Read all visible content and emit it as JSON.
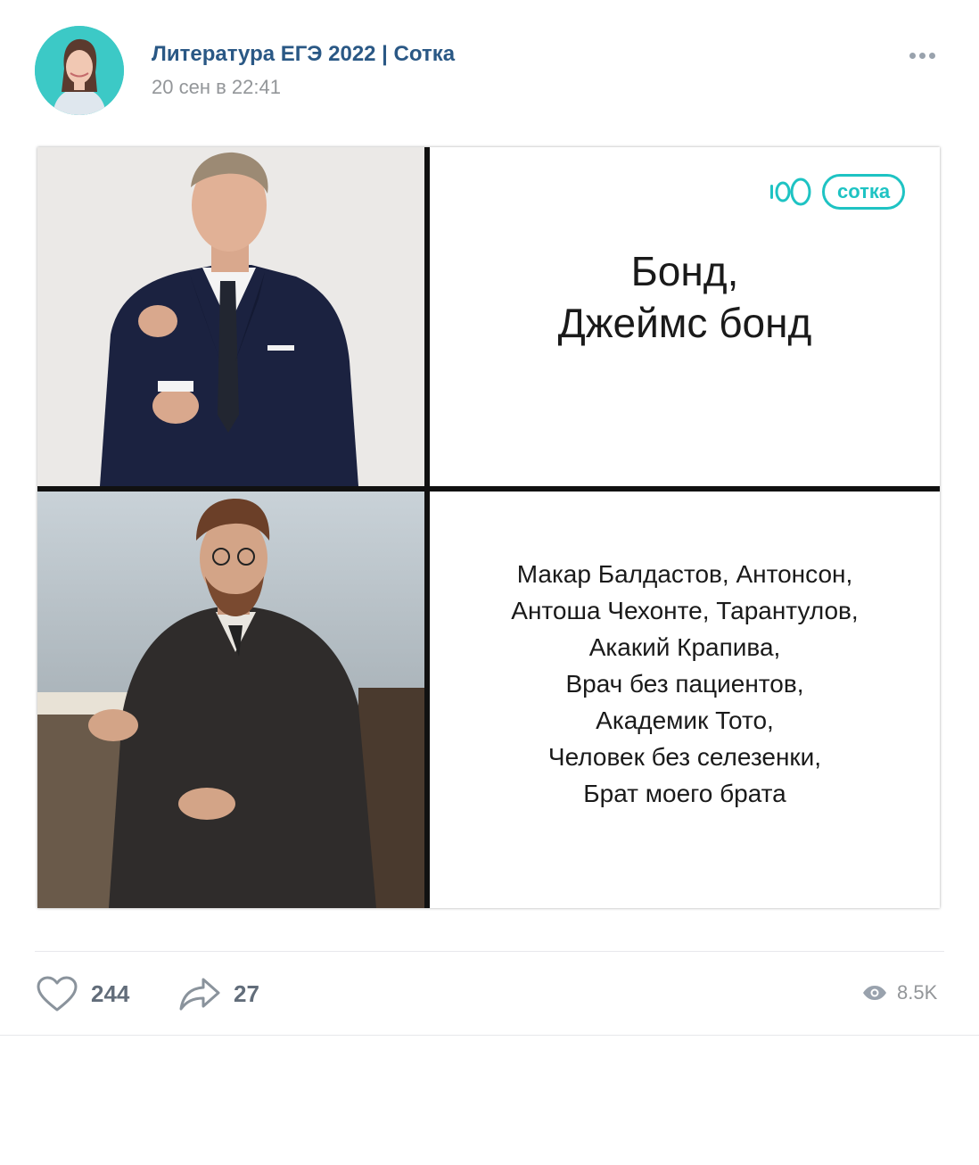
{
  "post": {
    "author": "Литература ЕГЭ 2022 | Сотка",
    "date": "20 сен в 22:41"
  },
  "meme": {
    "brand": "сотка",
    "brand_prefix": "100",
    "top_text": [
      "Бонд,",
      "Джеймс бонд"
    ],
    "bottom_text": [
      "Макар Балдастов, Антонсон,",
      "Антоша Чехонте, Тарантулов,",
      "Акакий Крапива,",
      "Врач без пациентов,",
      "Академик Тото,",
      "Человек без селезенки,",
      "Брат моего брата"
    ]
  },
  "footer": {
    "likes": "244",
    "shares": "27",
    "views": "8.5K"
  },
  "colors": {
    "author_link": "#2a5885",
    "brand_teal": "#1ec3c3",
    "counter": "#626d7a"
  },
  "icons": {
    "like": "heart-icon",
    "share": "share-arrow-icon",
    "views": "eye-icon",
    "more": "more-dots-icon"
  }
}
